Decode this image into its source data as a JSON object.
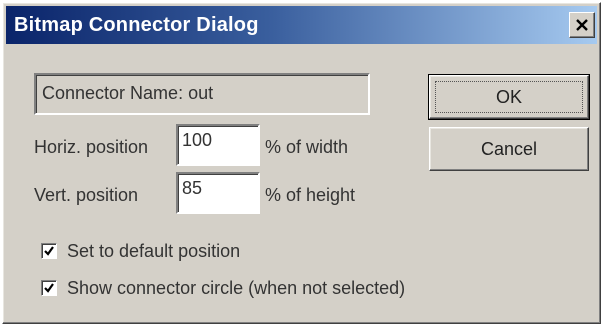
{
  "window": {
    "title": "Bitmap Connector Dialog",
    "close_glyph": "X"
  },
  "connector_name": "Connector Name: out",
  "buttons": {
    "ok_label": "OK",
    "cancel_label": "Cancel"
  },
  "horizontal": {
    "label": "Horiz. position",
    "value": "100",
    "unit": "% of width"
  },
  "vertical": {
    "label": "Vert. position",
    "value": "85",
    "unit": "% of height"
  },
  "checkboxes": [
    {
      "label": "Set to default position",
      "checked": true
    },
    {
      "label": "Show connector circle (when not selected)",
      "checked": true
    }
  ],
  "colors": {
    "titlebar_start": "#0a246a",
    "titlebar_end": "#a6caf0",
    "face": "#d4d0c8"
  }
}
